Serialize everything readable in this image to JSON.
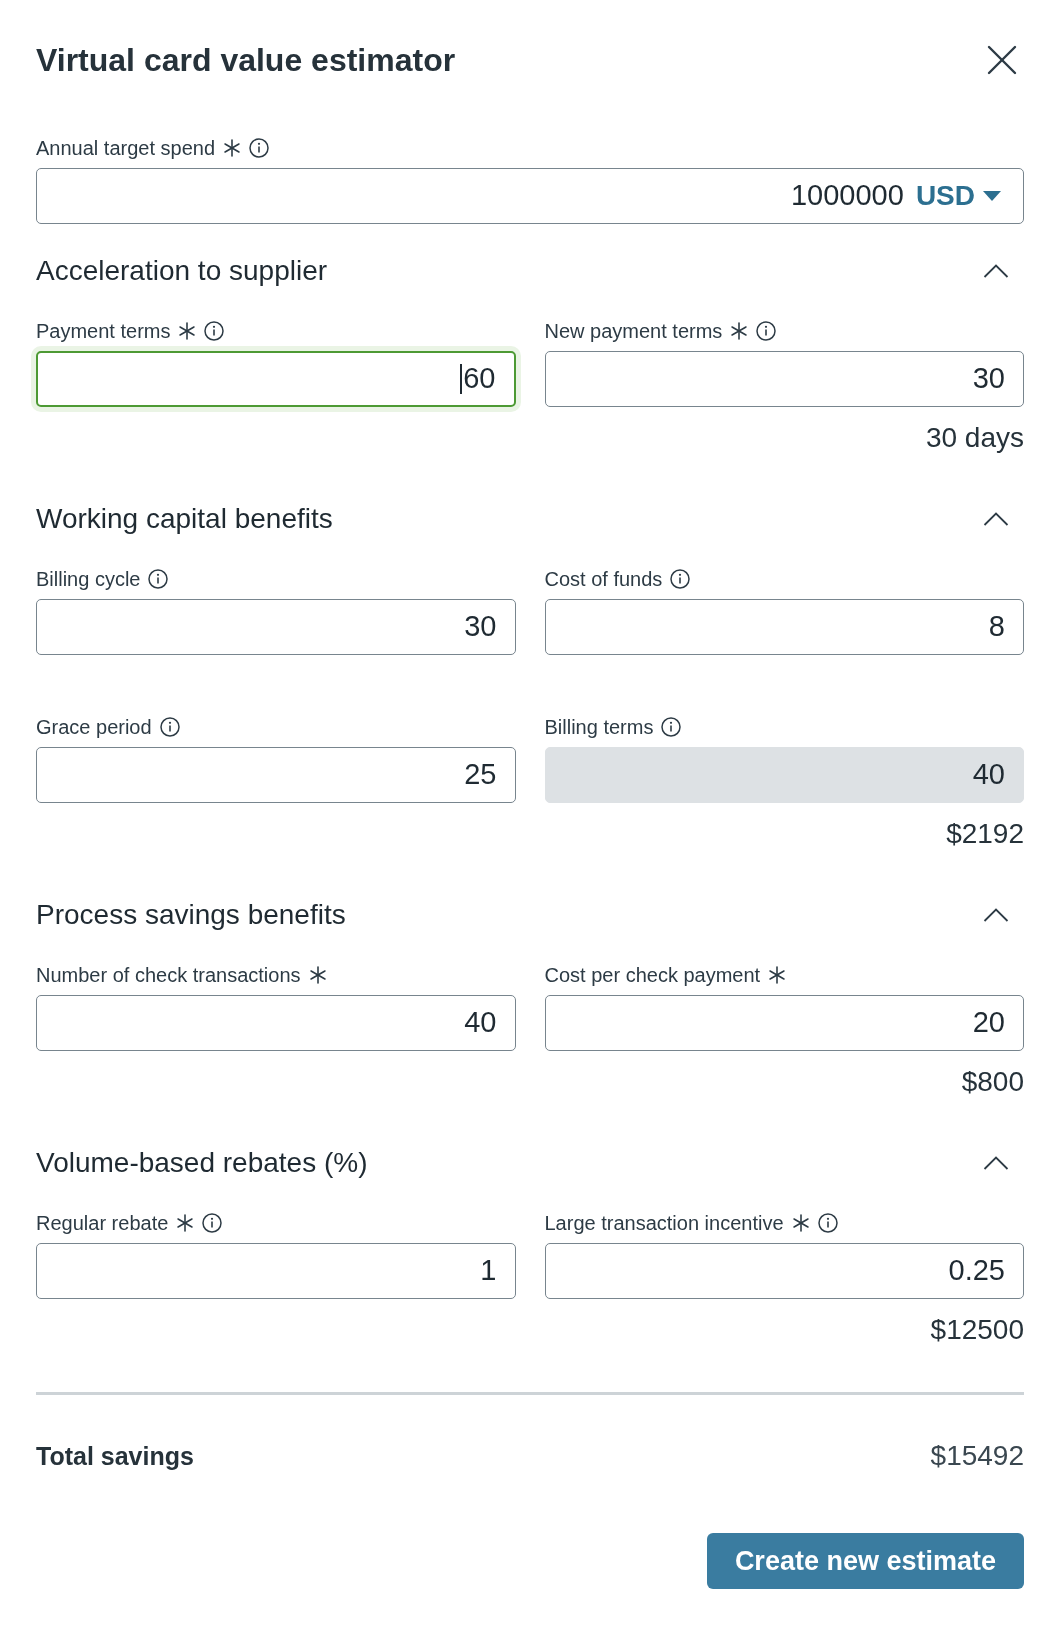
{
  "dialog": {
    "title": "Virtual card value estimator"
  },
  "annual_target_spend": {
    "label": "Annual target spend",
    "required": true,
    "info": true,
    "value": "1000000",
    "currency": "USD"
  },
  "sections": [
    {
      "title": "Acceleration to supplier",
      "expanded": true,
      "fields": [
        {
          "label": "Payment terms",
          "required": true,
          "info": true,
          "value": "60",
          "focused": true,
          "disabled": false
        },
        {
          "label": "New payment terms",
          "required": true,
          "info": true,
          "value": "30",
          "focused": false,
          "disabled": false
        }
      ],
      "result": "30 days"
    },
    {
      "title": "Working capital benefits",
      "expanded": true,
      "fields": [
        {
          "label": "Billing cycle",
          "required": false,
          "info": true,
          "value": "30",
          "focused": false,
          "disabled": false
        },
        {
          "label": "Cost of funds",
          "required": false,
          "info": true,
          "value": "8",
          "focused": false,
          "disabled": false
        },
        {
          "label": "Grace period",
          "required": false,
          "info": true,
          "value": "25",
          "focused": false,
          "disabled": false
        },
        {
          "label": "Billing terms",
          "required": false,
          "info": true,
          "value": "40",
          "focused": false,
          "disabled": true
        }
      ],
      "result": "$2192"
    },
    {
      "title": "Process savings benefits",
      "expanded": true,
      "fields": [
        {
          "label": "Number of check transactions",
          "required": true,
          "info": false,
          "value": "40",
          "focused": false,
          "disabled": false
        },
        {
          "label": "Cost per check payment",
          "required": true,
          "info": false,
          "value": "20",
          "focused": false,
          "disabled": false
        }
      ],
      "result": "$800"
    },
    {
      "title": "Volume-based rebates (%)",
      "expanded": true,
      "fields": [
        {
          "label": "Regular rebate",
          "required": true,
          "info": true,
          "value": "1",
          "focused": false,
          "disabled": false
        },
        {
          "label": "Large transaction incentive",
          "required": true,
          "info": true,
          "value": "0.25",
          "focused": false,
          "disabled": false
        }
      ],
      "result": "$12500"
    }
  ],
  "total": {
    "label": "Total savings",
    "value": "$15492"
  },
  "button": {
    "label": "Create new estimate"
  }
}
